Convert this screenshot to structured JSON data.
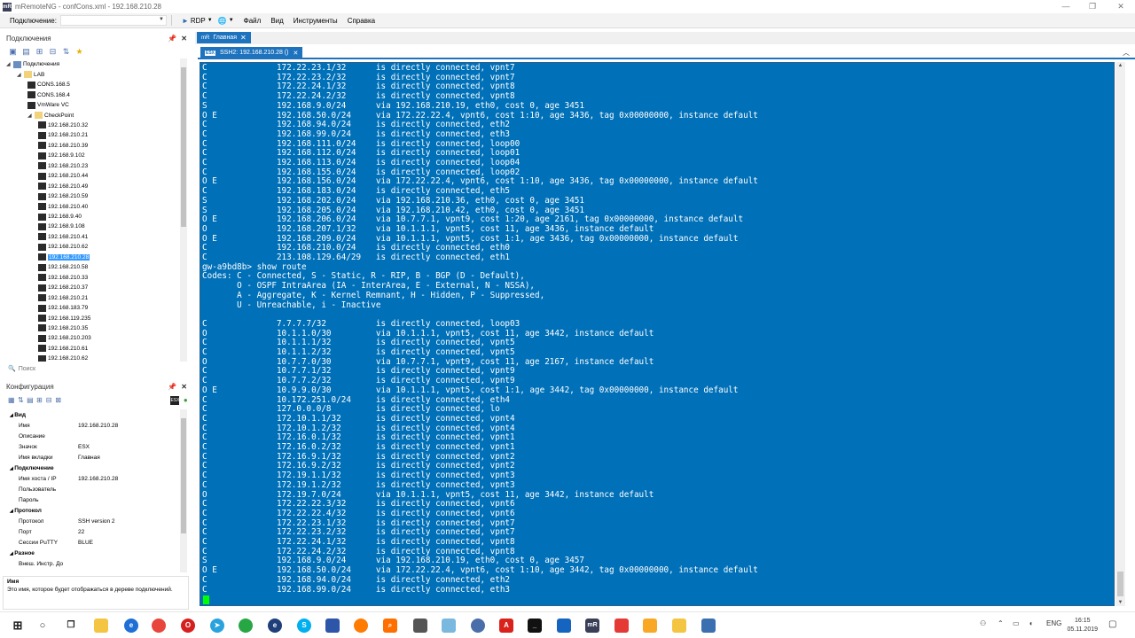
{
  "window": {
    "title": "mRemoteNG - confCons.xml - 192.168.210.28",
    "minimize": "—",
    "maximize": "❐",
    "close": "✕"
  },
  "toolbar": {
    "connect_label": "Подключение:",
    "rdp_label": "RDP",
    "menus": [
      "Файл",
      "Вид",
      "Инструменты",
      "Справка"
    ]
  },
  "connections_panel": {
    "title": "Подключения",
    "tree": [
      {
        "label": "Подключения",
        "level": 0,
        "kind": "root",
        "exp": "◢"
      },
      {
        "label": "LAB",
        "level": 1,
        "kind": "folder",
        "exp": "◢"
      },
      {
        "label": "CONS.168.5",
        "level": 2,
        "kind": "host"
      },
      {
        "label": "CONS.168.4",
        "level": 2,
        "kind": "host"
      },
      {
        "label": "VmWare VC",
        "level": 2,
        "kind": "host"
      },
      {
        "label": "CheckPoint",
        "level": 2,
        "kind": "folder",
        "exp": "◢"
      },
      {
        "label": "192.168.210.32",
        "level": 3,
        "kind": "host"
      },
      {
        "label": "192.168.210.21",
        "level": 3,
        "kind": "host"
      },
      {
        "label": "192.168.210.39",
        "level": 3,
        "kind": "host"
      },
      {
        "label": "192.168.9.102",
        "level": 3,
        "kind": "host"
      },
      {
        "label": "192.168.210.23",
        "level": 3,
        "kind": "host"
      },
      {
        "label": "192.168.210.44",
        "level": 3,
        "kind": "host"
      },
      {
        "label": "192.168.210.49",
        "level": 3,
        "kind": "host"
      },
      {
        "label": "192.168.210.59",
        "level": 3,
        "kind": "host"
      },
      {
        "label": "192.168.210.40",
        "level": 3,
        "kind": "host"
      },
      {
        "label": "192.168.9.40",
        "level": 3,
        "kind": "host"
      },
      {
        "label": "192.168.9.108",
        "level": 3,
        "kind": "host"
      },
      {
        "label": "192.168.210.41",
        "level": 3,
        "kind": "host"
      },
      {
        "label": "192.168.210.62",
        "level": 3,
        "kind": "host"
      },
      {
        "label": "192.168.210.28",
        "level": 3,
        "kind": "host",
        "selected": true
      },
      {
        "label": "192.168.210.58",
        "level": 3,
        "kind": "host"
      },
      {
        "label": "192.168.210.33",
        "level": 3,
        "kind": "host"
      },
      {
        "label": "192.168.210.37",
        "level": 3,
        "kind": "host"
      },
      {
        "label": "192.168.210.21",
        "level": 3,
        "kind": "host"
      },
      {
        "label": "192.168.183.79",
        "level": 3,
        "kind": "host"
      },
      {
        "label": "192.168.119.235",
        "level": 3,
        "kind": "host"
      },
      {
        "label": "192.168.210.35",
        "level": 3,
        "kind": "host"
      },
      {
        "label": "192.168.210.203",
        "level": 3,
        "kind": "host"
      },
      {
        "label": "192.168.210.61",
        "level": 3,
        "kind": "host"
      },
      {
        "label": "192.168.210.62",
        "level": 3,
        "kind": "host"
      }
    ],
    "search_placeholder": "Поиск"
  },
  "config_panel": {
    "title": "Конфигурация",
    "rows": [
      {
        "name": "Вид",
        "value": "",
        "cat": true
      },
      {
        "name": "Имя",
        "value": "192.168.210.28"
      },
      {
        "name": "Описание",
        "value": ""
      },
      {
        "name": "Значок",
        "value": "ESX"
      },
      {
        "name": "Имя вкладки",
        "value": "Главная"
      },
      {
        "name": "Подключение",
        "value": "",
        "cat": true
      },
      {
        "name": "Имя хоста / IP",
        "value": "192.168.210.28"
      },
      {
        "name": "Пользователь",
        "value": ""
      },
      {
        "name": "Пароль",
        "value": ""
      },
      {
        "name": "Протокол",
        "value": "",
        "cat": true
      },
      {
        "name": "Протокол",
        "value": "SSH version 2"
      },
      {
        "name": "Порт",
        "value": "22"
      },
      {
        "name": "Сессии PuTTY",
        "value": "BLUE"
      },
      {
        "name": "Разное",
        "value": "",
        "cat": true
      },
      {
        "name": "Внеш. Инстр. До",
        "value": ""
      }
    ],
    "desc_title": "Имя",
    "desc_text": "Это имя, которое будет отображаться в дереве подключений."
  },
  "tabs": {
    "main_tab": "Главная",
    "session_tab": "SSH2: 192.168.210.28 ()",
    "esx_badge": "ESX"
  },
  "terminal": {
    "lines": [
      "C              172.22.23.1/32      is directly connected, vpnt7",
      "C              172.22.23.2/32      is directly connected, vpnt7",
      "C              172.22.24.1/32      is directly connected, vpnt8",
      "C              172.22.24.2/32      is directly connected, vpnt8",
      "S              192.168.9.0/24      via 192.168.210.19, eth0, cost 0, age 3451",
      "O E            192.168.50.0/24     via 172.22.22.4, vpnt6, cost 1:10, age 3436, tag 0x00000000, instance default",
      "C              192.168.94.0/24     is directly connected, eth2",
      "C              192.168.99.0/24     is directly connected, eth3",
      "C              192.168.111.0/24    is directly connected, loop00",
      "C              192.168.112.0/24    is directly connected, loop01",
      "C              192.168.113.0/24    is directly connected, loop04",
      "C              192.168.155.0/24    is directly connected, loop02",
      "O E            192.168.156.0/24    via 172.22.22.4, vpnt6, cost 1:10, age 3436, tag 0x00000000, instance default",
      "C              192.168.183.0/24    is directly connected, eth5",
      "S              192.168.202.0/24    via 192.168.210.36, eth0, cost 0, age 3451",
      "S              192.168.205.0/24    via 192.168.210.42, eth0, cost 0, age 3451",
      "O E            192.168.206.0/24    via 10.7.7.1, vpnt9, cost 1:20, age 2161, tag 0x00000000, instance default",
      "O              192.168.207.1/32    via 10.1.1.1, vpnt5, cost 11, age 3436, instance default",
      "O E            192.168.209.0/24    via 10.1.1.1, vpnt5, cost 1:1, age 3436, tag 0x00000000, instance default",
      "C              192.168.210.0/24    is directly connected, eth0",
      "C              213.108.129.64/29   is directly connected, eth1",
      "gw-a9bd8b> show route",
      "Codes: C - Connected, S - Static, R - RIP, B - BGP (D - Default),",
      "       O - OSPF IntraArea (IA - InterArea, E - External, N - NSSA),",
      "       A - Aggregate, K - Kernel Remnant, H - Hidden, P - Suppressed,",
      "       U - Unreachable, i - Inactive",
      "",
      "C              7.7.7.7/32          is directly connected, loop03",
      "O              10.1.1.0/30         via 10.1.1.1, vpnt5, cost 11, age 3442, instance default",
      "C              10.1.1.1/32         is directly connected, vpnt5",
      "C              10.1.1.2/32         is directly connected, vpnt5",
      "O              10.7.7.0/30         via 10.7.7.1, vpnt9, cost 11, age 2167, instance default",
      "C              10.7.7.1/32         is directly connected, vpnt9",
      "C              10.7.7.2/32         is directly connected, vpnt9",
      "O E            10.9.9.0/30         via 10.1.1.1, vpnt5, cost 1:1, age 3442, tag 0x00000000, instance default",
      "C              10.172.251.0/24     is directly connected, eth4",
      "C              127.0.0.0/8         is directly connected, lo",
      "C              172.10.1.1/32       is directly connected, vpnt4",
      "C              172.10.1.2/32       is directly connected, vpnt4",
      "C              172.16.0.1/32       is directly connected, vpnt1",
      "C              172.16.0.2/32       is directly connected, vpnt1",
      "C              172.16.9.1/32       is directly connected, vpnt2",
      "C              172.16.9.2/32       is directly connected, vpnt2",
      "C              172.19.1.1/32       is directly connected, vpnt3",
      "C              172.19.1.2/32       is directly connected, vpnt3",
      "O              172.19.7.0/24       via 10.1.1.1, vpnt5, cost 11, age 3442, instance default",
      "C              172.22.22.3/32      is directly connected, vpnt6",
      "C              172.22.22.4/32      is directly connected, vpnt6",
      "C              172.22.23.1/32      is directly connected, vpnt7",
      "C              172.22.23.2/32      is directly connected, vpnt7",
      "C              172.22.24.1/32      is directly connected, vpnt8",
      "C              172.22.24.2/32      is directly connected, vpnt8",
      "S              192.168.9.0/24      via 192.168.210.19, eth0, cost 0, age 3457",
      "O E            192.168.50.0/24     via 172.22.22.4, vpnt6, cost 1:10, age 3442, tag 0x00000000, instance default",
      "C              192.168.94.0/24     is directly connected, eth2",
      "C              192.168.99.0/24     is directly connected, eth3"
    ]
  },
  "taskbar": {
    "lang": "ENG",
    "time": "16:15",
    "date": "05.11.2019"
  }
}
